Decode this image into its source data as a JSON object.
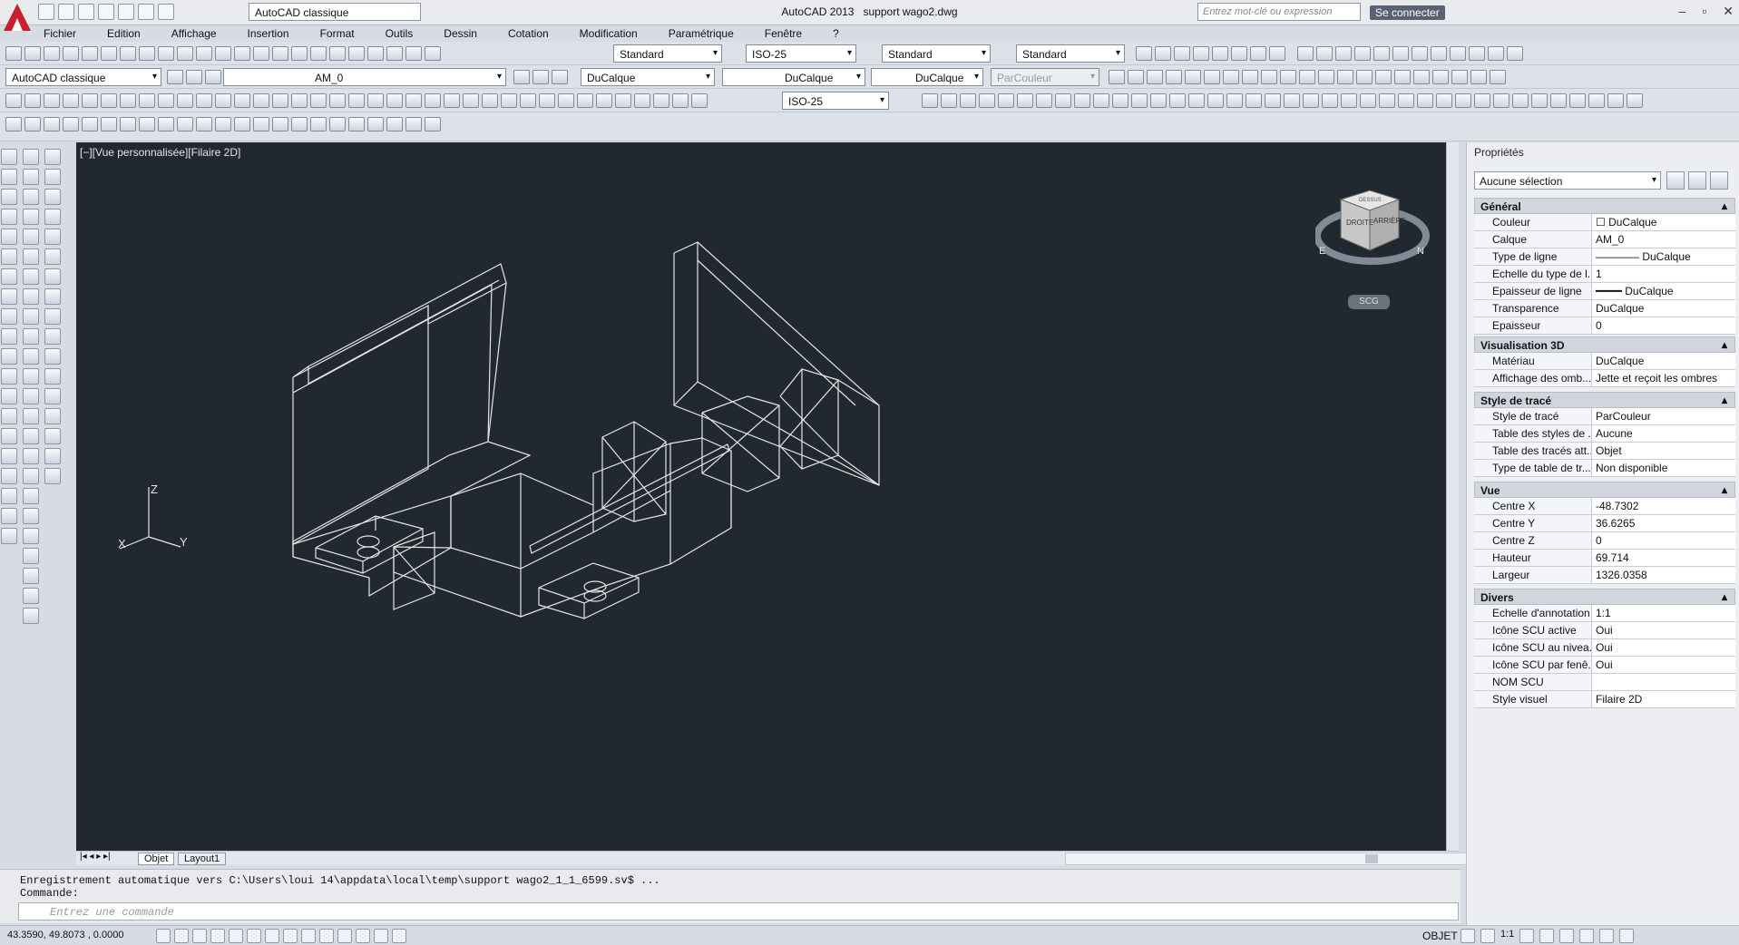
{
  "app": {
    "window_title": "AutoCAD 2013",
    "file_name": "support wago2.dwg",
    "workspace": "AutoCAD classique",
    "search_placeholder": "Entrez mot-clé ou expression",
    "sign_in": "Se connecter",
    "help": "?"
  },
  "menu": [
    "Fichier",
    "Edition",
    "Affichage",
    "Insertion",
    "Format",
    "Outils",
    "Dessin",
    "Cotation",
    "Modification",
    "Paramétrique",
    "Fenêtre",
    "?"
  ],
  "toolbars": {
    "text_style": "Standard",
    "dim_style": "ISO-25",
    "table_style": "Standard",
    "multileader_style": "Standard",
    "workspace2": "AutoCAD classique",
    "layer": "AM_0",
    "color": "DuCalque",
    "linetype": "DuCalque",
    "lineweight": "DuCalque",
    "plotstyle": "ParCouleur",
    "dim_style2": "ISO-25"
  },
  "viewport": {
    "label": "[−][Vue personnalisée][Filaire 2D]",
    "scg": "SCG",
    "ucs_z": "Z",
    "ucs_y": "Y",
    "ucs_x": "X",
    "cube_left": "DROITE",
    "cube_right": "ARRIÈRE",
    "cube_top": "DESSUS",
    "compass_w": "E",
    "compass_e": "N"
  },
  "tabs": [
    "Objet",
    "Layout1"
  ],
  "command": {
    "line1": "Enregistrement automatique vers C:\\Users\\loui 14\\appdata\\local\\temp\\support wago2_1_1_6599.sv$ ...",
    "line2": "Commande:",
    "placeholder": "Entrez une commande"
  },
  "status": {
    "coords": "43.3590, 49.8073 , 0.0000",
    "model": "OBJET",
    "scale": "1:1"
  },
  "properties": {
    "title": "Propriétés",
    "selection": "Aucune sélection",
    "sections": [
      {
        "name": "Général",
        "rows": [
          {
            "k": "Couleur",
            "v": "☐ DuCalque"
          },
          {
            "k": "Calque",
            "v": "AM_0"
          },
          {
            "k": "Type de ligne",
            "v": "———— DuCalque"
          },
          {
            "k": "Echelle du type de l...",
            "v": "1"
          },
          {
            "k": "Epaisseur de ligne",
            "v": "━━━━ DuCalque"
          },
          {
            "k": "Transparence",
            "v": "DuCalque"
          },
          {
            "k": "Epaisseur",
            "v": "0"
          }
        ]
      },
      {
        "name": "Visualisation 3D",
        "rows": [
          {
            "k": "Matériau",
            "v": "DuCalque"
          },
          {
            "k": "Affichage des omb...",
            "v": "Jette et reçoit les ombres"
          }
        ]
      },
      {
        "name": "Style de tracé",
        "rows": [
          {
            "k": "Style de tracé",
            "v": "ParCouleur"
          },
          {
            "k": "Table des styles de ...",
            "v": "Aucune"
          },
          {
            "k": "Table des tracés att...",
            "v": "Objet"
          },
          {
            "k": "Type de table de tr...",
            "v": "Non disponible"
          }
        ]
      },
      {
        "name": "Vue",
        "rows": [
          {
            "k": "Centre X",
            "v": "-48.7302"
          },
          {
            "k": "Centre Y",
            "v": "36.6265"
          },
          {
            "k": "Centre Z",
            "v": "0"
          },
          {
            "k": "Hauteur",
            "v": "69.714"
          },
          {
            "k": "Largeur",
            "v": "1326.0358"
          }
        ]
      },
      {
        "name": "Divers",
        "rows": [
          {
            "k": "Echelle d'annotation",
            "v": "1:1"
          },
          {
            "k": "Icône SCU active",
            "v": "Oui"
          },
          {
            "k": "Icône SCU au nivea...",
            "v": "Oui"
          },
          {
            "k": "Icône SCU par fenê...",
            "v": "Oui"
          },
          {
            "k": "NOM SCU",
            "v": ""
          },
          {
            "k": "Style visuel",
            "v": "Filaire 2D"
          }
        ]
      }
    ]
  }
}
